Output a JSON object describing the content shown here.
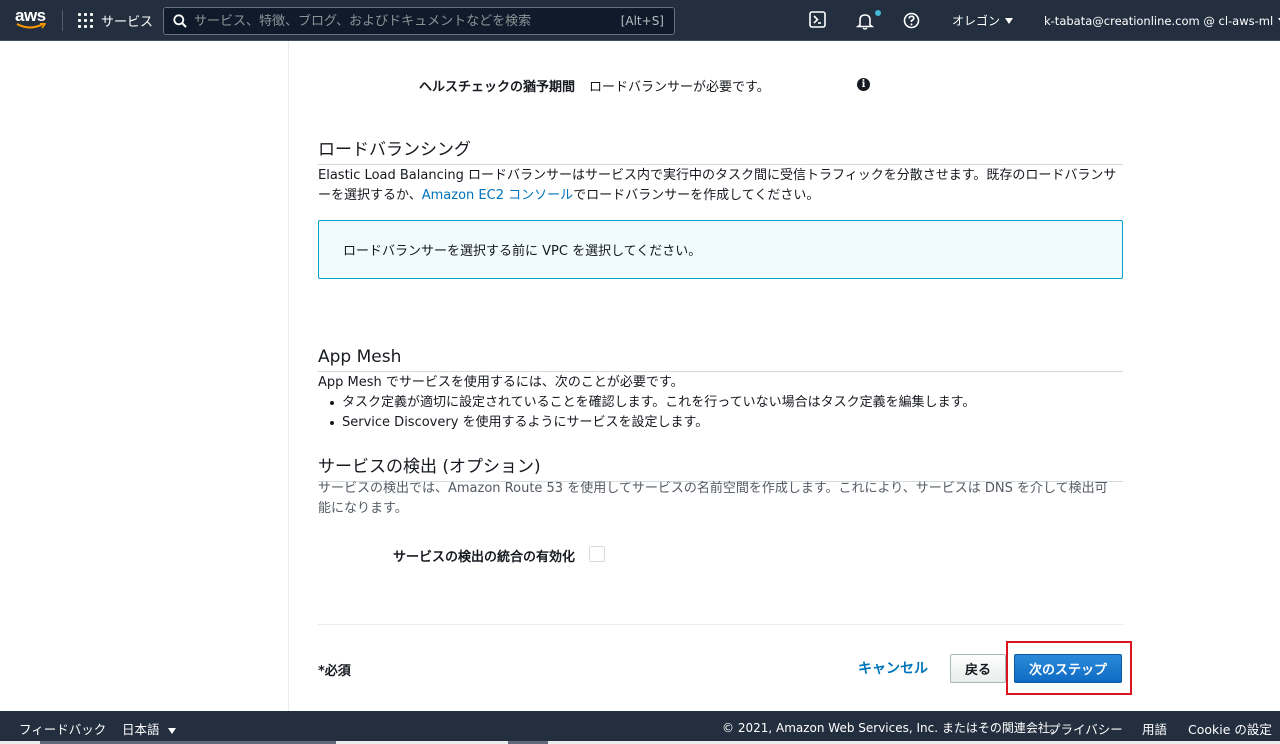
{
  "nav": {
    "logo_text": "aws",
    "services_label": "サービス",
    "search_placeholder": "サービス、特徴、ブログ、およびドキュメントなどを検索",
    "search_shortcut": "[Alt+S]",
    "region": "オレゴン",
    "account": "k-tabata@creationline.com @ cl-aws-ml"
  },
  "health_check": {
    "label": "ヘルスチェックの猶予期間",
    "value": "ロードバランサーが必要です。"
  },
  "load_balancing": {
    "title": "ロードバランシング",
    "desc_before_link": "Elastic Load Balancing ロードバランサーはサービス内で実行中のタスク間に受信トラフィックを分散させます。既存のロードバランサーを選択するか、",
    "link": "Amazon EC2 コンソール",
    "desc_after_link": "でロードバランサーを作成してください。",
    "info_box": "ロードバランサーを選択する前に VPC を選択してください。"
  },
  "app_mesh": {
    "title": "App Mesh",
    "intro": "App Mesh でサービスを使用するには、次のことが必要です。",
    "bullets": [
      "タスク定義が適切に設定されていることを確認します。これを行っていない場合はタスク定義を編集します。",
      "Service Discovery を使用するようにサービスを設定します。"
    ]
  },
  "service_discovery": {
    "title": "サービスの検出 (オプション)",
    "desc": "サービスの検出では、Amazon Route 53 を使用してサービスの名前空間を作成します。これにより、サービスは DNS を介して検出可能になります。",
    "enable_label": "サービスの検出の統合の有効化",
    "enabled": false
  },
  "actions": {
    "required": "*必須",
    "cancel": "キャンセル",
    "back": "戻る",
    "next": "次のステップ"
  },
  "footer": {
    "feedback": "フィードバック",
    "language": "日本語",
    "copyright": "© 2021, Amazon Web Services, Inc. またはその関連会社。",
    "privacy": "プライバシー",
    "terms": "用語",
    "cookie": "Cookie の設定"
  },
  "colors": {
    "nav_bg": "#232f3e",
    "link": "#0073bb",
    "primary_button": "#0f6bc4",
    "highlight": "#d8141c",
    "info_box_bg": "#f1faff",
    "info_box_border": "#00a1c9"
  }
}
